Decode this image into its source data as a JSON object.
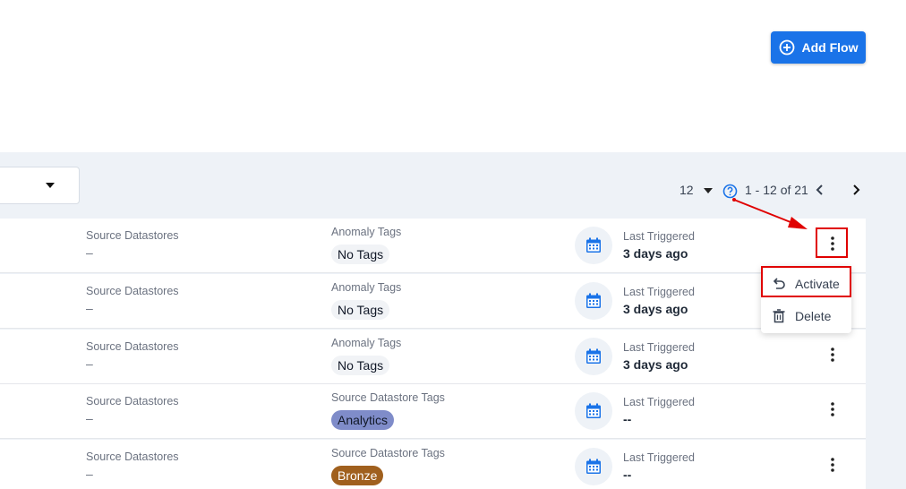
{
  "header": {
    "add_flow_label": "Add Flow",
    "accent_color": "#1a73e8"
  },
  "pager": {
    "per_page": "12",
    "range": "1 - 12 of 21"
  },
  "rows": [
    {
      "col1_label": "Source Datastores",
      "col1_value": "–",
      "tags_label": "Anomaly Tags",
      "tag": "No Tags",
      "tag_style": "plain",
      "trig_label": "Last Triggered",
      "trig_value": "3 days ago"
    },
    {
      "col1_label": "Source Datastores",
      "col1_value": "–",
      "tags_label": "Anomaly Tags",
      "tag": "No Tags",
      "tag_style": "plain",
      "trig_label": "Last Triggered",
      "trig_value": "3 days ago"
    },
    {
      "col1_label": "Source Datastores",
      "col1_value": "–",
      "tags_label": "Anomaly Tags",
      "tag": "No Tags",
      "tag_style": "plain",
      "trig_label": "Last Triggered",
      "trig_value": "3 days ago"
    },
    {
      "col1_label": "Source Datastores",
      "col1_value": "–",
      "tags_label": "Source Datastore Tags",
      "tag": "Analytics",
      "tag_style": "analytics",
      "trig_label": "Last Triggered",
      "trig_value": "--"
    },
    {
      "col1_label": "Source Datastores",
      "col1_value": "–",
      "tags_label": "Source Datastore Tags",
      "tag": "Bronze",
      "tag_style": "bronze",
      "trig_label": "Last Triggered",
      "trig_value": "--"
    }
  ],
  "menu": {
    "activate_label": "Activate",
    "delete_label": "Delete"
  },
  "icons": {
    "add": "plus-circle-icon",
    "help": "question-circle-icon",
    "calendar": "calendar-icon",
    "more": "kebab-menu-icon",
    "activate": "undo-icon",
    "delete": "trash-icon"
  },
  "annotation_color": "#e00000"
}
